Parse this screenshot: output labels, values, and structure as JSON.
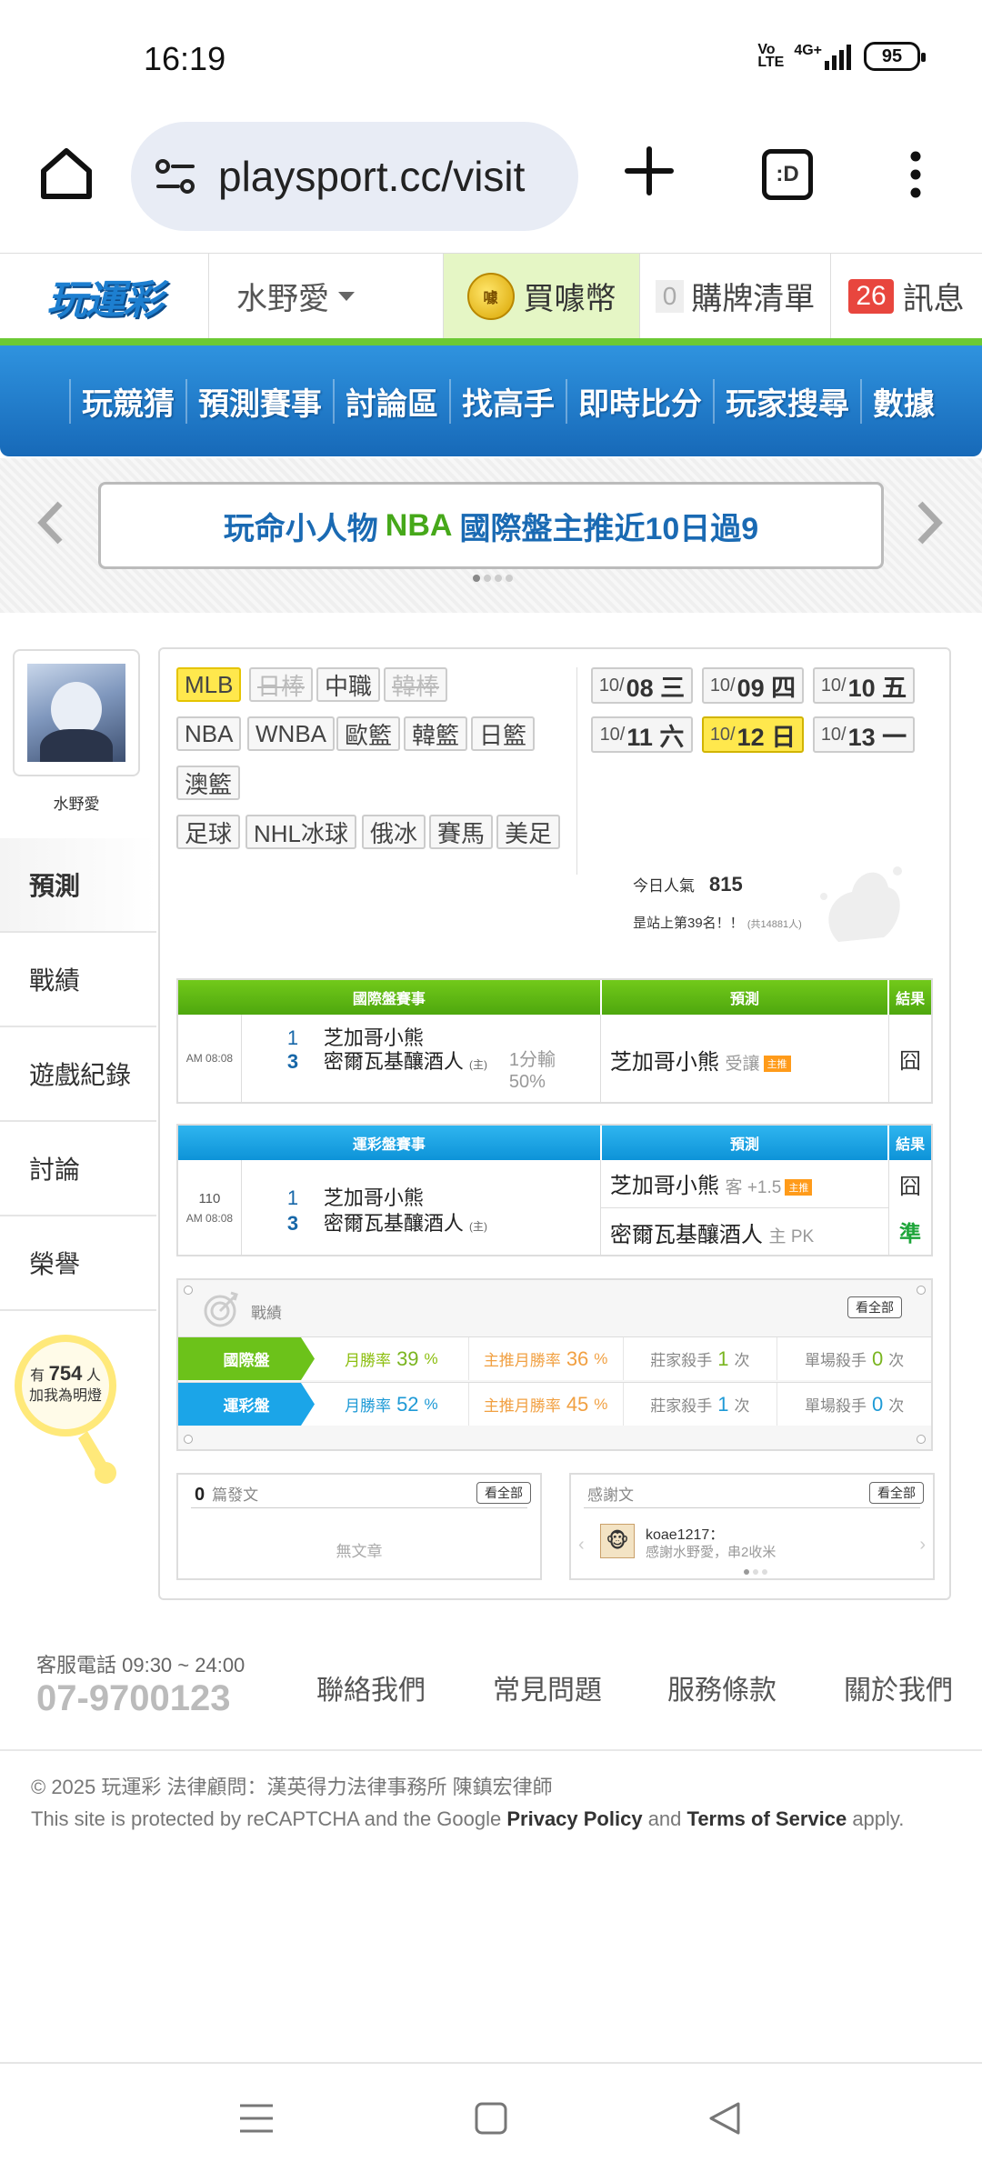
{
  "status": {
    "time": "16:19",
    "network": "4G+",
    "battery": "95",
    "volte": "Vo LTE"
  },
  "browser": {
    "url": "playsport.cc/visit",
    "tabs_label": ":D"
  },
  "header": {
    "logo": "玩運彩",
    "user": "水野愛",
    "buy_coin": "買噱幣",
    "coin_icon": "噱",
    "cart_count": "0",
    "cart_label": "購牌清單",
    "msg_count": "26",
    "msg_label": "訊息"
  },
  "nav": [
    "玩競猜",
    "預測賽事",
    "討論區",
    "找高手",
    "即時比分",
    "玩家搜尋",
    "數據"
  ],
  "banner": {
    "pre": "玩命小人物",
    "highlight": "NBA",
    "post": "國際盤主推近10日過9"
  },
  "profile": {
    "name": "水野愛"
  },
  "side_menu": [
    "預測",
    "戰績",
    "遊戲紀錄",
    "討論",
    "榮譽"
  ],
  "fans": {
    "pre": "有",
    "count": "754",
    "post": "人",
    "line2": "加我為明燈"
  },
  "leagues": {
    "row1": [
      "MLB",
      "日棒",
      "中職",
      "韓棒"
    ],
    "row2": [
      "NBA",
      "WNBA",
      "歐籃",
      "韓籃",
      "日籃"
    ],
    "row3": [
      "澳籃"
    ],
    "row4": [
      "足球",
      "NHL冰球",
      "俄冰",
      "賽馬",
      "美足"
    ]
  },
  "dates": [
    {
      "m": "10/",
      "d": "08 三"
    },
    {
      "m": "10/",
      "d": "09 四"
    },
    {
      "m": "10/",
      "d": "10 五"
    },
    {
      "m": "10/",
      "d": "11 六"
    },
    {
      "m": "10/",
      "d": "12 日"
    },
    {
      "m": "10/",
      "d": "13 一"
    }
  ],
  "popularity": {
    "label": "今日人氣",
    "value": "815",
    "rank": "昰站上第39名！！",
    "rank_note": "(共14881人)"
  },
  "intl_table": {
    "headers": [
      "國際盤賽事",
      "預測",
      "結果"
    ],
    "time": "AM 08:08",
    "away_num": "1",
    "away_team": "芝加哥小熊",
    "home_num": "3",
    "home_team": "密爾瓦基釀酒人",
    "home_mark": "(主)",
    "spread_line1": "1分輸",
    "spread_line2": "50%",
    "pick_team": "芝加哥小熊",
    "pick_type": "受讓",
    "pick_badge": "主推",
    "result": "囧"
  },
  "lottery_table": {
    "headers": [
      "運彩盤賽事",
      "預測",
      "結果"
    ],
    "game_no": "110",
    "time": "AM 08:08",
    "away_num": "1",
    "away_team": "芝加哥小熊",
    "home_num": "3",
    "home_team": "密爾瓦基釀酒人",
    "home_mark": "(主)",
    "pick1_team": "芝加哥小熊",
    "pick1_type": "客 +1.5",
    "pick1_badge": "主推",
    "result1": "囧",
    "pick2_team": "密爾瓦基釀酒人",
    "pick2_type": "主 PK",
    "result2": "準"
  },
  "record": {
    "title": "戰績",
    "view_all": "看全部",
    "rows": [
      {
        "label": "國際盤",
        "win_label": "月勝率",
        "win": "39",
        "main_label": "主推月勝率",
        "main": "36",
        "home_label": "莊家殺手",
        "home": "1",
        "single_label": "單場殺手",
        "single": "0",
        "unit_pct": "%",
        "unit_times": "次"
      },
      {
        "label": "運彩盤",
        "win_label": "月勝率",
        "win": "52",
        "main_label": "主推月勝率",
        "main": "45",
        "home_label": "莊家殺手",
        "home": "1",
        "single_label": "單場殺手",
        "single": "0",
        "unit_pct": "%",
        "unit_times": "次"
      }
    ]
  },
  "posts": {
    "count": "0",
    "label": "篇發文",
    "view_all": "看全部",
    "empty": "無文章"
  },
  "thanks": {
    "label": "感謝文",
    "view_all": "看全部",
    "user": "koae1217：",
    "text": "感謝水野愛，串2收米"
  },
  "footer": {
    "service": "客服電話 09:30 ~ 24:00",
    "phone": "07-9700123",
    "links": [
      "聯絡我們",
      "常見問題",
      "服務條款",
      "關於我們"
    ],
    "copyright": "© 2025 玩運彩 法律顧問：漢英得力法律事務所 陳鎮宏律師",
    "recaptcha_pre": "This site is protected by reCAPTCHA and the Google ",
    "privacy": "Privacy Policy",
    "and": " and ",
    "terms": "Terms of Service",
    "apply": " apply."
  },
  "colors": {
    "nav_blue": "#1769b8",
    "green": "#4ea70e",
    "sky": "#0d93d8",
    "yellow": "#ffe84d"
  }
}
